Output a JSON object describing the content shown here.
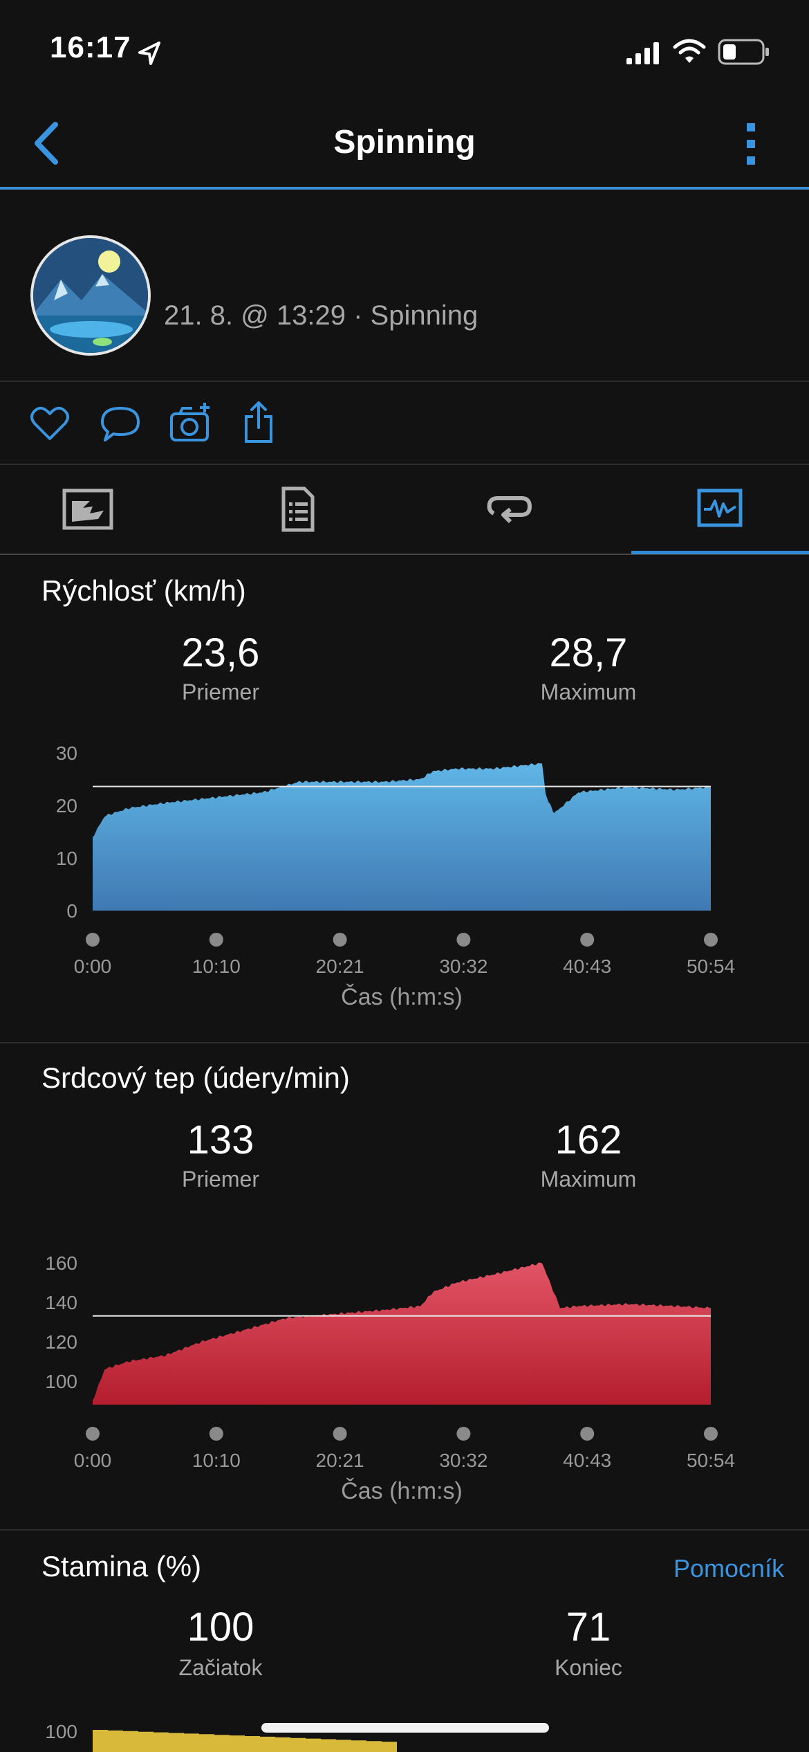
{
  "status_bar": {
    "time": "16:17"
  },
  "header": {
    "title": "Spinning"
  },
  "activity": {
    "meta": "21. 8. @ 13:29 · Spinning"
  },
  "sections": {
    "speed": {
      "title": "Rýchlosť (km/h)",
      "avg_value": "23,6",
      "avg_label": "Priemer",
      "max_value": "28,7",
      "max_label": "Maximum"
    },
    "heart": {
      "title": "Srdcový tep (údery/min)",
      "avg_value": "133",
      "avg_label": "Priemer",
      "max_value": "162",
      "max_label": "Maximum"
    },
    "stamina": {
      "title": "Stamina (%)",
      "helper": "Pomocník",
      "start_value": "100",
      "start_label": "Začiatok",
      "end_value": "71",
      "end_label": "Koniec"
    }
  },
  "chart_data": [
    {
      "type": "area",
      "title": "Rýchlosť (km/h)",
      "xlabel": "Čas (h:m:s)",
      "x_ticks": [
        "0:00",
        "10:10",
        "20:21",
        "30:32",
        "40:43",
        "50:54"
      ],
      "y_ticks": [
        "0",
        "10",
        "20",
        "30"
      ],
      "ylim": [
        0,
        30
      ],
      "x": [
        0,
        1,
        3,
        6,
        10,
        14,
        17,
        20,
        24,
        27,
        28,
        30,
        33,
        35,
        37,
        37.3,
        38,
        40,
        44,
        48,
        50.9
      ],
      "values": [
        14,
        18,
        19.5,
        20.5,
        21.5,
        22.5,
        24.5,
        24.5,
        24.5,
        25,
        26.5,
        27,
        27,
        27.5,
        28,
        22,
        18.5,
        22.5,
        23.5,
        23,
        23.5
      ],
      "reference_line": 23.6,
      "color": "#4ea6dc"
    },
    {
      "type": "area",
      "title": "Srdcový tep (údery/min)",
      "xlabel": "Čas (h:m:s)",
      "x_ticks": [
        "0:00",
        "10:10",
        "20:21",
        "30:32",
        "40:43",
        "50:54"
      ],
      "y_ticks": [
        "100",
        "120",
        "140",
        "160"
      ],
      "ylim": [
        88,
        168
      ],
      "x": [
        0,
        1,
        3,
        6,
        9,
        12,
        16,
        20,
        24,
        27,
        28,
        30,
        33,
        35,
        37,
        38.5,
        40,
        44,
        48,
        50.9
      ],
      "values": [
        90,
        106,
        110,
        113,
        120,
        125,
        132,
        134,
        136,
        138,
        145,
        150,
        154,
        157,
        160,
        137,
        138,
        139,
        138,
        137
      ],
      "reference_line": 133,
      "color": "#d02f3e"
    },
    {
      "type": "area",
      "title": "Stamina (%)",
      "y_ticks": [
        "100"
      ],
      "start": 100,
      "end": 71,
      "color": "#d9b93a"
    }
  ]
}
